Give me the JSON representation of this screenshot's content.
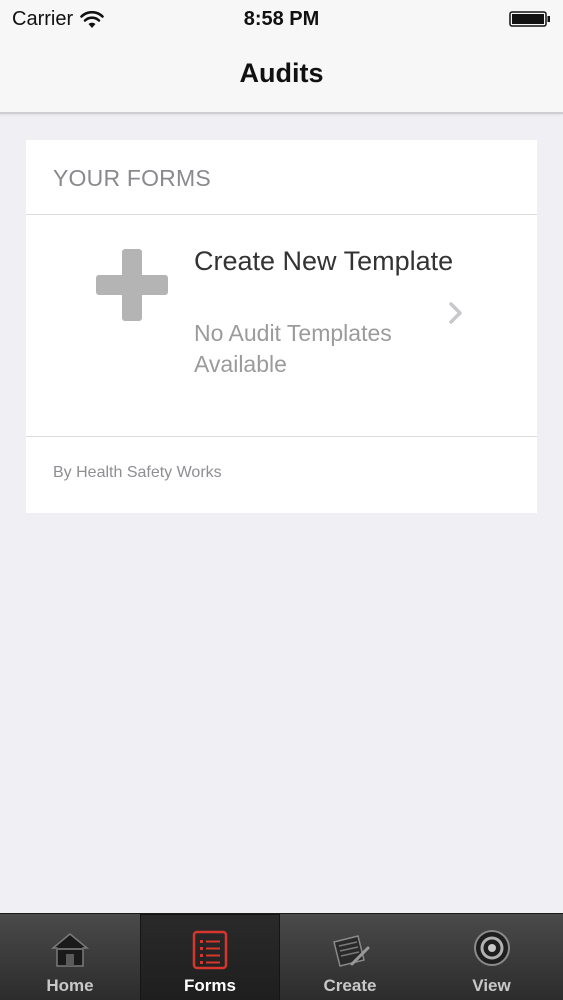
{
  "status_bar": {
    "carrier": "Carrier",
    "time": "8:58 PM"
  },
  "nav": {
    "title": "Audits"
  },
  "forms_section": {
    "header": "YOUR FORMS",
    "template_row": {
      "title": "Create New Template",
      "subtitle": "No Audit Templates Available",
      "icon": "plus-icon"
    },
    "footer": "By Health Safety Works"
  },
  "tab_bar": {
    "tabs": [
      {
        "label": "Home",
        "icon": "home-icon",
        "active": false
      },
      {
        "label": "Forms",
        "icon": "list-icon",
        "active": true
      },
      {
        "label": "Create",
        "icon": "edit-document-icon",
        "active": false
      },
      {
        "label": "View",
        "icon": "eye-icon",
        "active": false
      }
    ]
  },
  "colors": {
    "background": "#efeff4",
    "accent_active_tab_icon": "#d6362c",
    "plus_icon": "#b4b4b4"
  }
}
